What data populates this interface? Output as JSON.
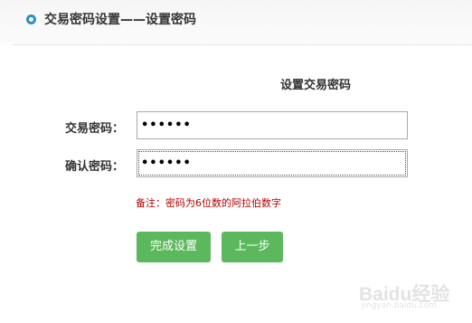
{
  "header": {
    "title": "交易密码设置——设置密码",
    "icon": "radio-dot-icon",
    "icon_color": "#2a8fcc"
  },
  "form": {
    "section_title": "设置交易密码",
    "password_label": "交易密码：",
    "password_value": "••••••",
    "confirm_label": "确认密码：",
    "confirm_value": "••••••",
    "note": "备注：密码为6位数的阿拉伯数字",
    "note_color": "#b40000"
  },
  "buttons": {
    "complete_label": "完成设置",
    "back_label": "上一步",
    "color": "#5cb85c"
  },
  "watermark": {
    "brand": "Baidu经验",
    "url": "jingyan.baidu.com"
  }
}
